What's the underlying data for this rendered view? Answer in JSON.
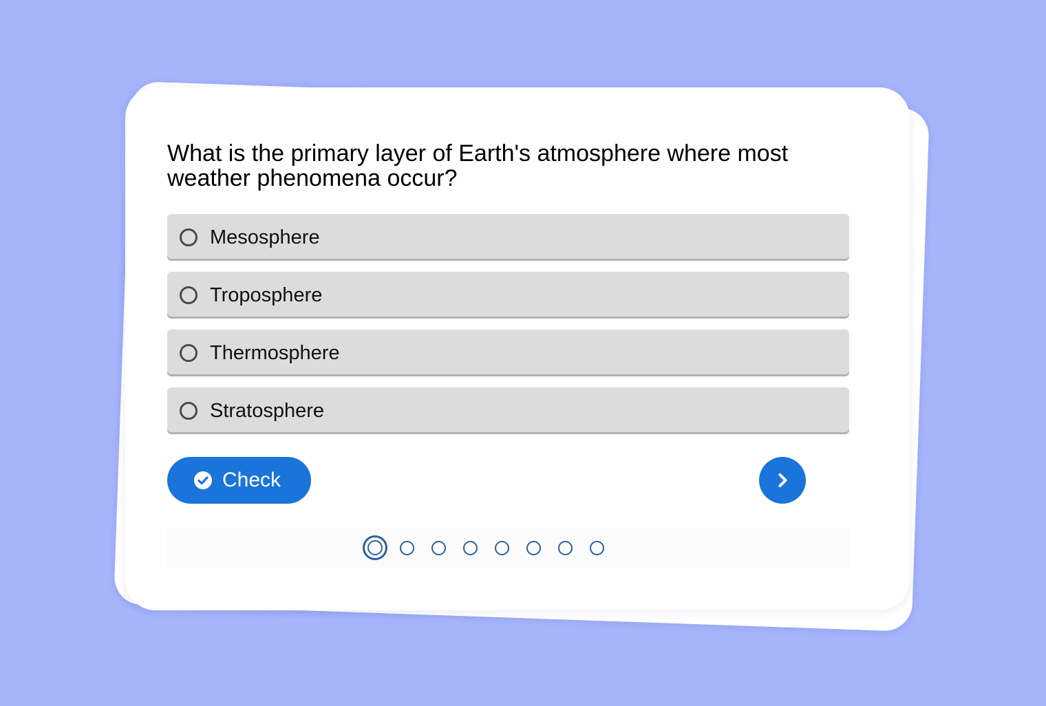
{
  "quiz": {
    "question": "What is the primary layer of Earth's atmosphere where most weather phenomena occur?",
    "options": [
      {
        "label": "Mesosphere",
        "selected": false
      },
      {
        "label": "Troposphere",
        "selected": false
      },
      {
        "label": "Thermosphere",
        "selected": false
      },
      {
        "label": "Stratosphere",
        "selected": false
      }
    ],
    "check_label": "Check",
    "check_icon": "check-circle-icon",
    "next_icon": "chevron-right-icon",
    "pagination": {
      "total": 8,
      "current": 1
    }
  },
  "colors": {
    "background": "#a5b4fb",
    "accent": "#1b74d9",
    "option_bg": "#dcdcdc",
    "pager_dot": "#2f5f9e"
  }
}
